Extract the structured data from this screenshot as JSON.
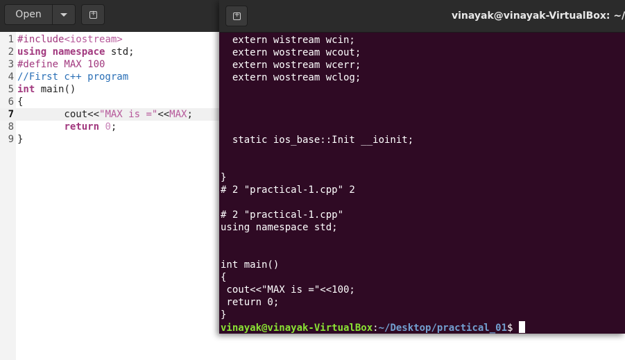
{
  "editor": {
    "open_label": "Open",
    "current_line": 7,
    "lines": [
      {
        "n": "1",
        "parts": [
          {
            "t": "#include",
            "c": "pp"
          },
          {
            "t": "<iostream>",
            "c": "str"
          }
        ]
      },
      {
        "n": "2",
        "parts": [
          {
            "t": "using",
            "c": "kw"
          },
          {
            "t": " ",
            "c": "plain"
          },
          {
            "t": "namespace",
            "c": "kw"
          },
          {
            "t": " std;",
            "c": "plain"
          }
        ]
      },
      {
        "n": "3",
        "parts": [
          {
            "t": "#define MAX 100",
            "c": "pp"
          }
        ]
      },
      {
        "n": "4",
        "parts": [
          {
            "t": "//First c++ program",
            "c": "cm"
          }
        ]
      },
      {
        "n": "5",
        "parts": [
          {
            "t": "int",
            "c": "kw"
          },
          {
            "t": " main()",
            "c": "plain"
          }
        ]
      },
      {
        "n": "6",
        "parts": [
          {
            "t": "{",
            "c": "plain"
          }
        ]
      },
      {
        "n": "7",
        "parts": [
          {
            "t": "        cout<<",
            "c": "plain"
          },
          {
            "t": "\"MAX is =\"",
            "c": "str"
          },
          {
            "t": "<<",
            "c": "plain"
          },
          {
            "t": "MAX",
            "c": "str"
          },
          {
            "t": ";",
            "c": "plain"
          }
        ]
      },
      {
        "n": "8",
        "parts": [
          {
            "t": "        ",
            "c": "plain"
          },
          {
            "t": "return",
            "c": "kw"
          },
          {
            "t": " ",
            "c": "plain"
          },
          {
            "t": "0",
            "c": "nm"
          },
          {
            "t": ";",
            "c": "plain"
          }
        ]
      },
      {
        "n": "9",
        "parts": [
          {
            "t": "}",
            "c": "plain"
          }
        ]
      }
    ]
  },
  "terminal": {
    "title": "vinayak@vinayak-VirtualBox: ~/Des",
    "output_lines": [
      "  extern wistream wcin;",
      "  extern wostream wcout;",
      "  extern wostream wcerr;",
      "  extern wostream wclog;",
      "",
      "",
      "",
      "",
      "  static ios_base::Init __ioinit;",
      "",
      "",
      "}",
      "# 2 \"practical-1.cpp\" 2",
      "",
      "# 2 \"practical-1.cpp\"",
      "using namespace std;",
      "",
      "",
      "int main()",
      "{",
      " cout<<\"MAX is =\"<<100;",
      " return 0;",
      "}"
    ],
    "prompt": {
      "user_host": "vinayak@vinayak-VirtualBox",
      "colon": ":",
      "path": "~/Desktop/practical_01",
      "dollar": "$"
    }
  },
  "icons": {
    "open_menu": "chevron-down-icon",
    "new_tab": "new-tab-icon"
  },
  "colors": {
    "terminal_bg": "#2f0a24",
    "header_bg": "#2c2c2c",
    "keyword": "#a1387e",
    "comment": "#2a6fb6",
    "prompt_user": "#8ae234",
    "prompt_path": "#729fcf"
  }
}
